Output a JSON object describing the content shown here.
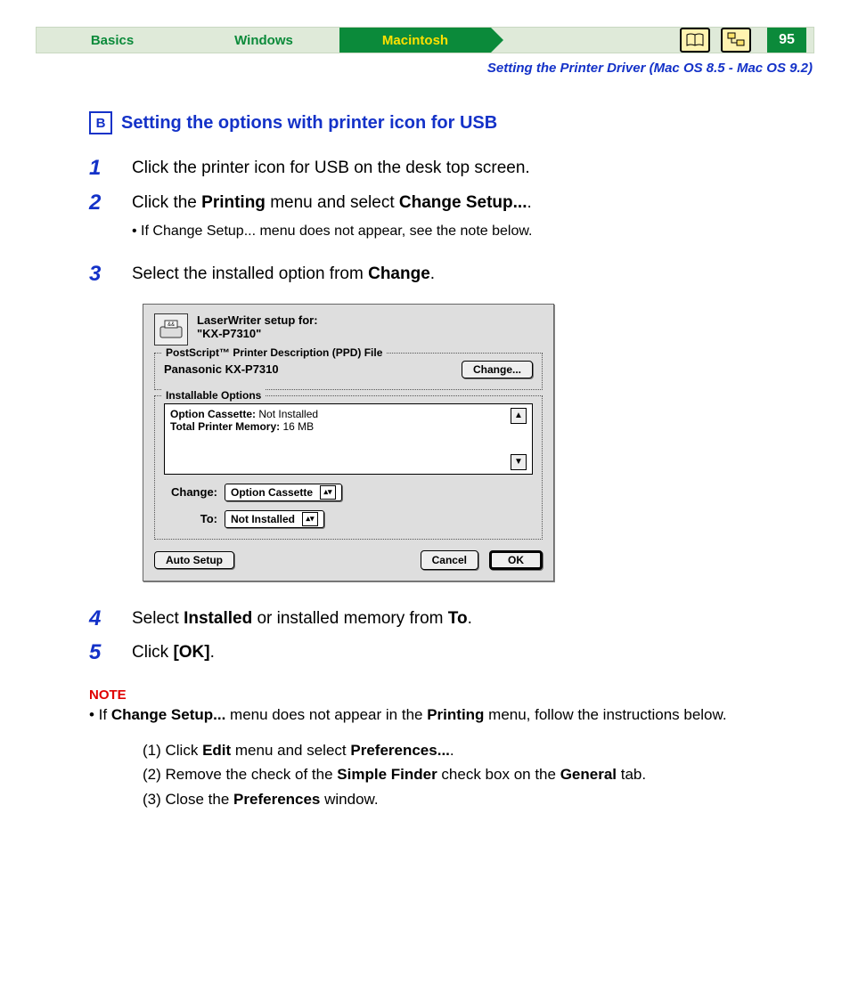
{
  "tabs": {
    "basics": "Basics",
    "windows": "Windows",
    "macintosh": "Macintosh"
  },
  "page_number": "95",
  "subhead": "Setting the Printer Driver (Mac OS 8.5 - Mac OS 9.2)",
  "section_letter": "B",
  "section_title": "Setting the options with printer icon for USB",
  "steps": {
    "s1": "Click the printer icon for USB on the desk top screen.",
    "s2_pre": "Click the ",
    "s2_b1": "Printing",
    "s2_mid": " menu and select ",
    "s2_b2": "Change Setup...",
    "s2_post": ".",
    "s2_sub": "If Change Setup... menu does not appear, see the note below.",
    "s3_pre": "Select the installed option from ",
    "s3_b": "Change",
    "s3_post": ".",
    "s4_pre": "Select ",
    "s4_b1": "Installed",
    "s4_mid": " or installed memory from ",
    "s4_b2": "To",
    "s4_post": ".",
    "s5_pre": "Click ",
    "s5_b": "[OK]",
    "s5_post": "."
  },
  "nums": {
    "n1": "1",
    "n2": "2",
    "n3": "3",
    "n4": "4",
    "n5": "5"
  },
  "dialog": {
    "title_line1": "LaserWriter setup for:",
    "title_line2": "\"KX-P7310\"",
    "ppd_legend": "PostScript™ Printer Description (PPD) File",
    "ppd_value": "Panasonic KX-P7310",
    "change_btn": "Change...",
    "opt_legend": "Installable Options",
    "opt_line1_label": "Option Cassette:",
    "opt_line1_value": " Not Installed",
    "opt_line2_label": "Total Printer Memory:",
    "opt_line2_value": " 16 MB",
    "change_label": "Change:",
    "change_value": "Option Cassette",
    "to_label": "To:",
    "to_value": "Not Installed",
    "auto_setup": "Auto Setup",
    "cancel": "Cancel",
    "ok": "OK"
  },
  "note": {
    "label": "NOTE",
    "bullet_pre": "• If ",
    "bullet_b1": "Change Setup...",
    "bullet_mid": " menu does not appear in the ",
    "bullet_b2": "Printing",
    "bullet_post": " menu, follow the instructions below.",
    "s1_pre": "(1) Click ",
    "s1_b1": "Edit",
    "s1_mid": " menu and select ",
    "s1_b2": "Preferences...",
    "s1_post": ".",
    "s2_pre": "(2) Remove the check of the ",
    "s2_b1": "Simple Finder",
    "s2_mid": " check box on the ",
    "s2_b2": "General",
    "s2_post": " tab.",
    "s3_pre": "(3) Close the ",
    "s3_b": "Preferences",
    "s3_post": " window."
  }
}
